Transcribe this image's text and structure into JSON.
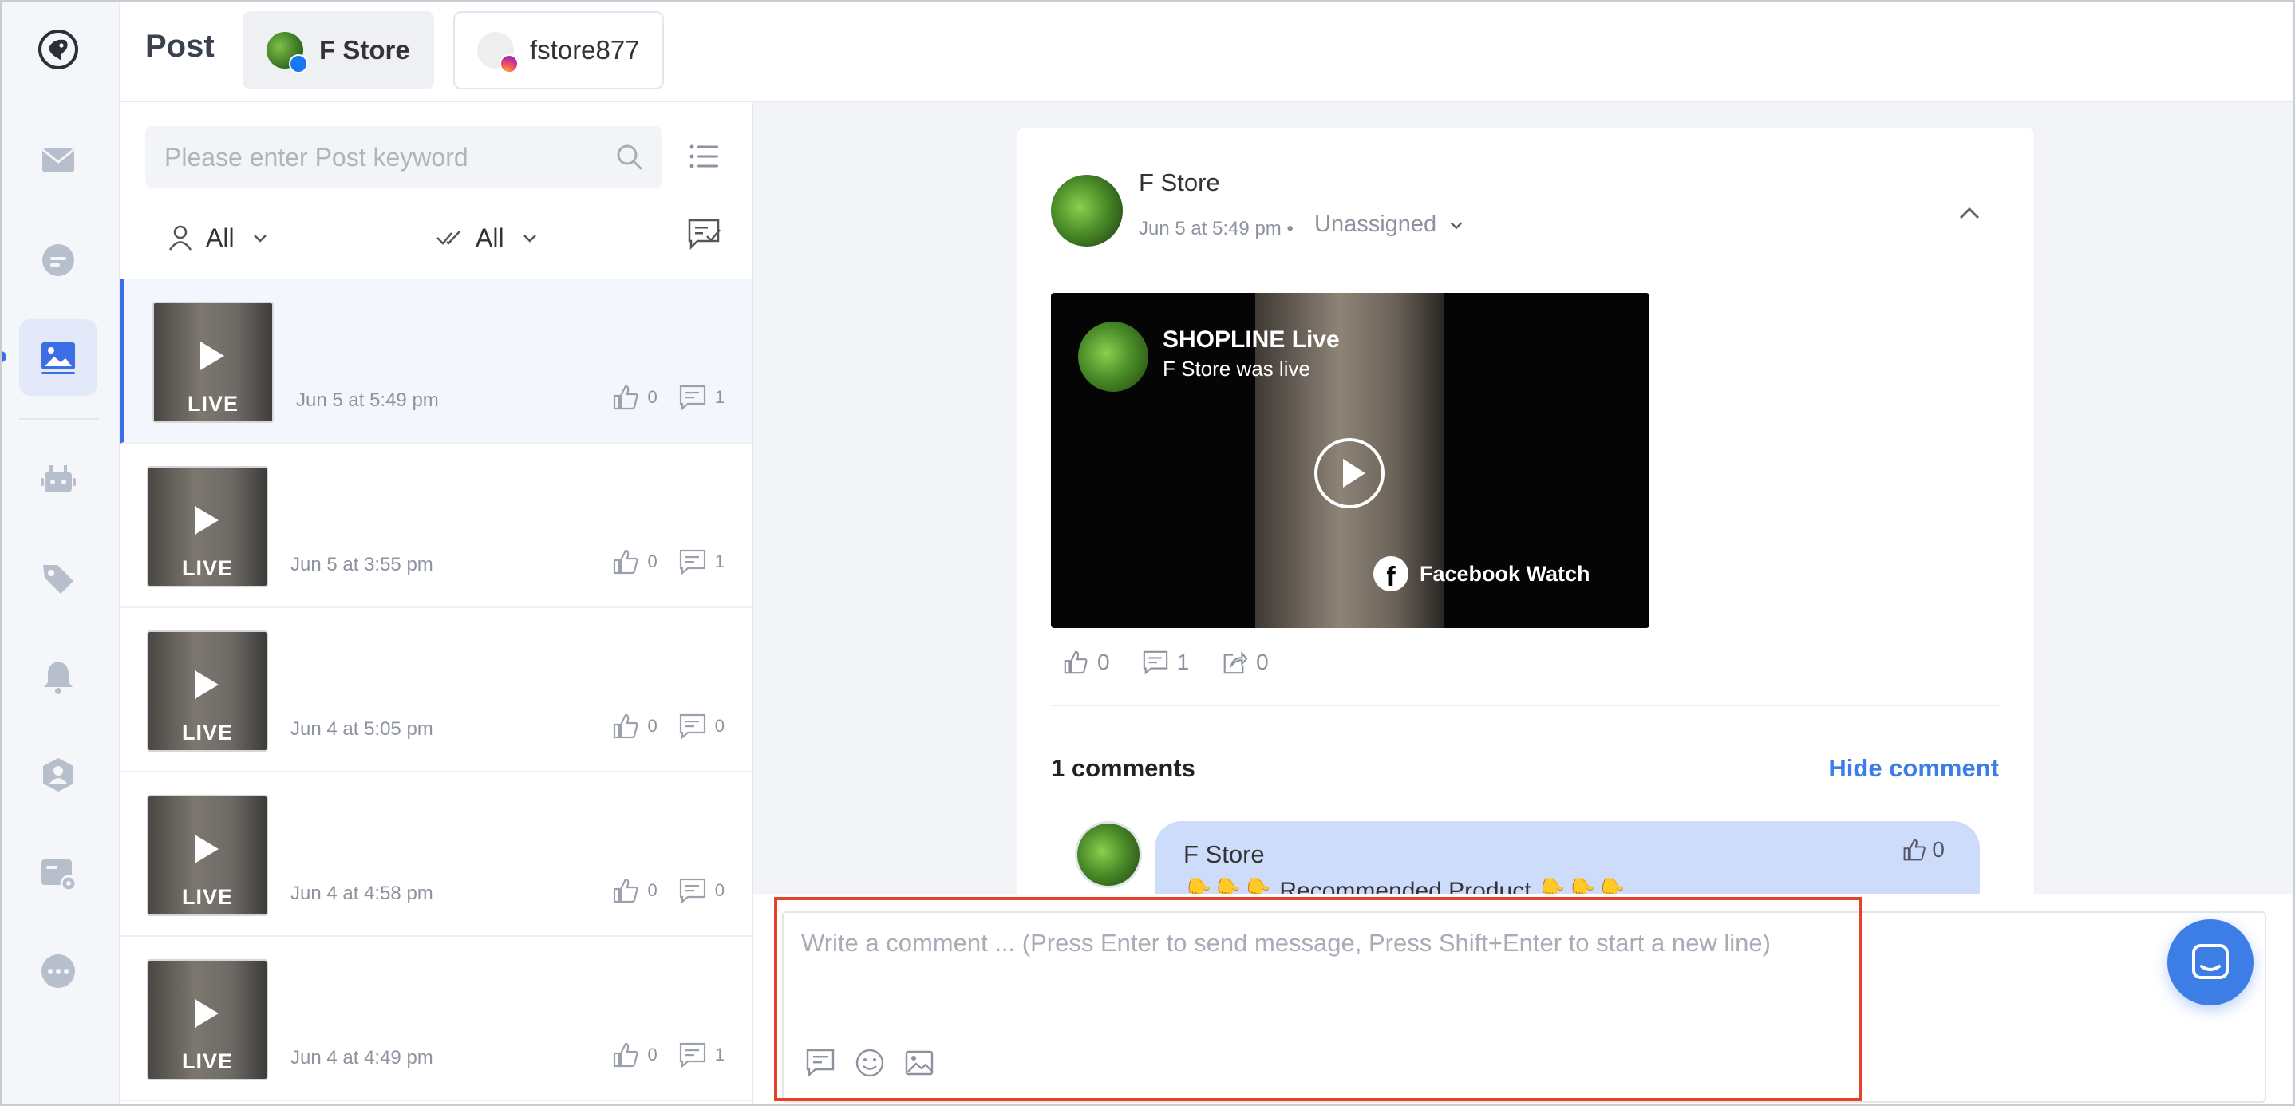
{
  "header": {
    "title": "Post",
    "accounts": [
      {
        "name": "F Store",
        "platform": "facebook",
        "active": true
      },
      {
        "name": "fstore877",
        "platform": "instagram",
        "active": false
      }
    ]
  },
  "sidebar": {
    "items": [
      {
        "icon": "mail-icon",
        "active": false
      },
      {
        "icon": "chat-icon",
        "active": false
      },
      {
        "icon": "image-post-icon",
        "active": true
      },
      {
        "icon": "robot-icon",
        "active": false
      },
      {
        "icon": "tag-icon",
        "active": false
      },
      {
        "icon": "bell-icon",
        "active": false
      },
      {
        "icon": "contact-icon",
        "active": false
      },
      {
        "icon": "settings-card-icon",
        "active": false
      },
      {
        "icon": "more-icon",
        "active": false
      }
    ]
  },
  "search": {
    "placeholder": "Please enter Post keyword",
    "value": ""
  },
  "filters": {
    "assignee": "All",
    "status": "All"
  },
  "posts": [
    {
      "badge": "LIVE",
      "date": "Jun 5 at 5:49 pm",
      "likes": "0",
      "comments": "1",
      "active": true
    },
    {
      "badge": "LIVE",
      "date": "Jun 5 at 3:55 pm",
      "likes": "0",
      "comments": "1",
      "active": false
    },
    {
      "badge": "LIVE",
      "date": "Jun 4 at 5:05 pm",
      "likes": "0",
      "comments": "0",
      "active": false
    },
    {
      "badge": "LIVE",
      "date": "Jun 4 at 4:58 pm",
      "likes": "0",
      "comments": "0",
      "active": false
    },
    {
      "badge": "LIVE",
      "date": "Jun 4 at 4:49 pm",
      "likes": "0",
      "comments": "1",
      "active": false
    }
  ],
  "detail": {
    "author": "F Store",
    "time": "Jun 5 at 5:49 pm",
    "separator": "•",
    "assignee": "Unassigned",
    "video": {
      "title": "SHOPLINE Live",
      "subtitle": "F Store was live",
      "watermark": "Facebook Watch"
    },
    "stats": {
      "likes": "0",
      "comments": "1",
      "shares": "0"
    },
    "comments_count": "1 comments",
    "hide_label": "Hide comment",
    "comment": {
      "author": "F Store",
      "text": "👇👇👇 Recommended Product 👇👇👇",
      "likes": "0"
    }
  },
  "composer": {
    "placeholder": "Write a comment ... (Press Enter to send message, Press Shift+Enter to start a new line)",
    "value": ""
  },
  "colors": {
    "accent": "#3c7ee6",
    "highlight": "#e2412a",
    "bubble": "#ccdcfa",
    "background": "#f3f4f7"
  }
}
